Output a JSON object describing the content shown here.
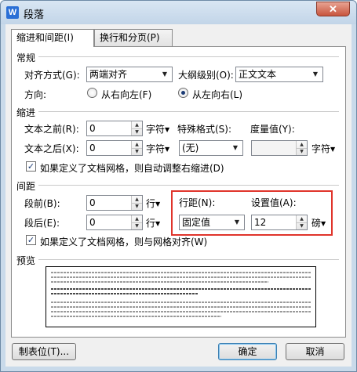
{
  "window": {
    "title": "段落",
    "app_icon": "W",
    "close_glyph": "✕"
  },
  "tabs": [
    {
      "label": "缩进和间距(I)"
    },
    {
      "label": "换行和分页(P)"
    }
  ],
  "general": {
    "title": "常规",
    "alignment_label": "对齐方式(G):",
    "alignment_value": "两端对齐",
    "outline_label": "大纲级别(O):",
    "outline_value": "正文文本",
    "direction_label": "方向:",
    "rtl_label": "从右向左(F)",
    "ltr_label": "从左向右(L)",
    "direction_selected": "ltr"
  },
  "indent": {
    "title": "缩进",
    "before_label": "文本之前(R):",
    "before_value": "0",
    "before_unit": "字符",
    "after_label": "文本之后(X):",
    "after_value": "0",
    "after_unit": "字符",
    "special_label": "特殊格式(S):",
    "special_value": "(无)",
    "measure_label": "度量值(Y):",
    "measure_value": "",
    "measure_unit": "字符",
    "grid_checkbox_label": "如果定义了文档网格，则自动调整右缩进(D)",
    "grid_checkbox_checked": true
  },
  "spacing": {
    "title": "间距",
    "before_label": "段前(B):",
    "before_value": "0",
    "before_unit": "行",
    "after_label": "段后(E):",
    "after_value": "0",
    "after_unit": "行",
    "line_spacing_label": "行距(N):",
    "line_spacing_value": "固定值",
    "set_value_label": "设置值(A):",
    "set_value": "12",
    "set_value_unit": "磅",
    "grid_checkbox_label": "如果定义了文档网格，则与网格对齐(W)",
    "grid_checkbox_checked": true
  },
  "preview": {
    "title": "预览"
  },
  "footer": {
    "tabs_button": "制表位(T)...",
    "ok_button": "确定",
    "cancel_button": "取消"
  },
  "colors": {
    "highlight": "#e0342b",
    "title_bar": "#c9daea"
  }
}
